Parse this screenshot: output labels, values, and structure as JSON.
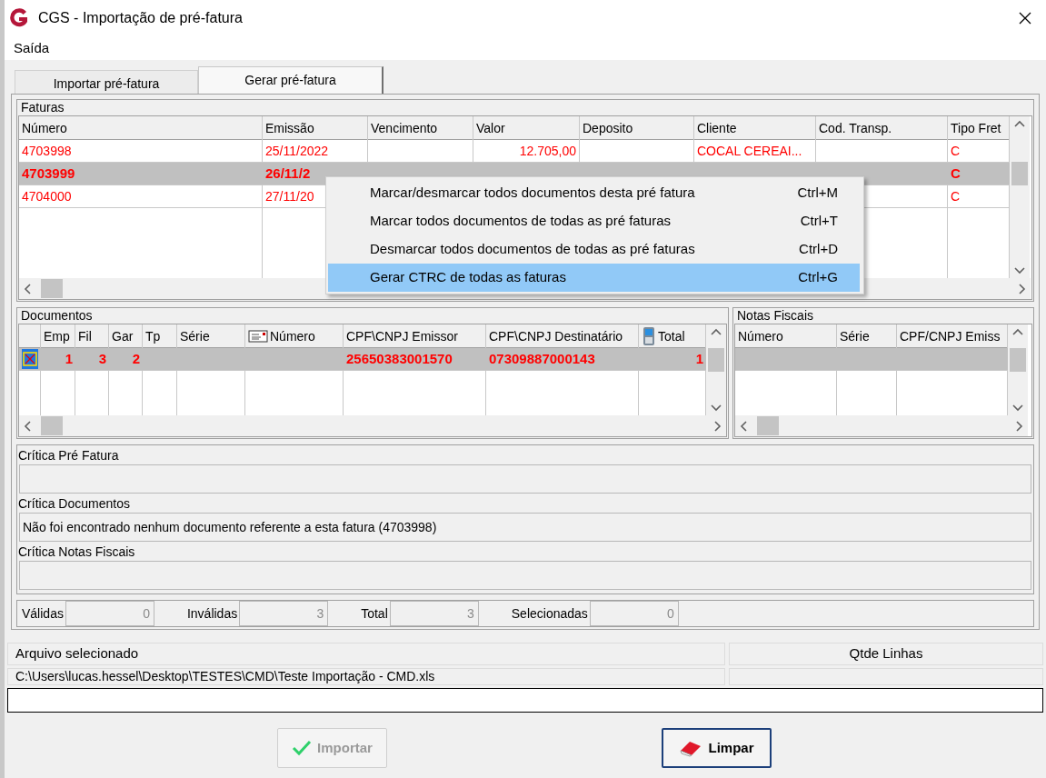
{
  "window": {
    "title": "CGS - Importação de pré-fatura"
  },
  "menu_bar": [
    "Saída"
  ],
  "tabs": [
    {
      "label": "Importar pré-fatura",
      "selected": false
    },
    {
      "label": "Gerar pré-fatura",
      "selected": true
    }
  ],
  "faturas": {
    "label": "Faturas",
    "columns": [
      "Número",
      "Emissão",
      "Vencimento",
      "Valor",
      "Deposito",
      "Cliente",
      "Cod. Transp.",
      "Tipo Fret"
    ],
    "rows": [
      {
        "selected": false,
        "cells": [
          "4703998",
          "25/11/2022",
          null,
          "12.705,00",
          null,
          "COCAL CEREAI...",
          null,
          "C"
        ]
      },
      {
        "selected": true,
        "cells": [
          "4703999",
          "26/11/2",
          null,
          null,
          null,
          null,
          null,
          "C"
        ]
      },
      {
        "selected": false,
        "cells": [
          "4704000",
          "27/11/20",
          null,
          null,
          null,
          null,
          null,
          "C"
        ]
      }
    ]
  },
  "context_menu": [
    {
      "label": "Marcar/desmarcar todos documentos desta pré fatura",
      "shortcut": "Ctrl+M",
      "selected": false
    },
    {
      "label": "Marcar todos documentos de todas as pré faturas",
      "shortcut": "Ctrl+T",
      "selected": false
    },
    {
      "label": "Desmarcar todos documentos de todas as pré faturas",
      "shortcut": "Ctrl+D",
      "selected": false
    },
    {
      "label": "Gerar CTRC de todas as faturas",
      "shortcut": "Ctrl+G",
      "selected": true
    }
  ],
  "documentos": {
    "label": "Documentos",
    "columns": [
      null,
      "Emp",
      "Fil",
      "Gar",
      "Tp",
      "Série",
      "Número",
      "CPF\\CNPJ Emissor",
      "CPF\\CNPJ Destinatário",
      "Total"
    ],
    "rows": [
      {
        "selected": true,
        "checked": true,
        "cells": [
          null,
          "1",
          "3",
          "2",
          null,
          null,
          null,
          "25650383001570",
          "07309887000143",
          "1"
        ]
      }
    ]
  },
  "notas_fiscais": {
    "label": "Notas Fiscais",
    "columns": [
      "Número",
      "Série",
      "CPF/CNPJ Emiss"
    ],
    "rows": [
      {
        "selected": true
      }
    ]
  },
  "criticas": [
    {
      "label": "Crítica Pré Fatura"
    },
    {
      "label": "Crítica Documentos",
      "text": "Não foi encontrado nenhum documento referente a esta fatura (4703998)"
    },
    {
      "label": "Crítica Notas Fiscais"
    }
  ],
  "counters": [
    {
      "label": "Válidas",
      "value": "0"
    },
    {
      "label": "Inválidas",
      "value": "3"
    },
    {
      "label": "Total",
      "value": "3"
    },
    {
      "label": "Selecionadas",
      "value": "0"
    }
  ],
  "file": {
    "columns": [
      "Arquivo selecionado",
      "Qtde Linhas"
    ],
    "path": "C:\\Users\\lucas.hessel\\Desktop\\TESTES\\CMD\\Teste Importação - CMD.xls"
  },
  "buttons": [
    {
      "label": "Importar",
      "kind": "confirm",
      "disabled": true
    },
    {
      "label": "Limpar",
      "kind": "clear",
      "disabled": false
    }
  ]
}
